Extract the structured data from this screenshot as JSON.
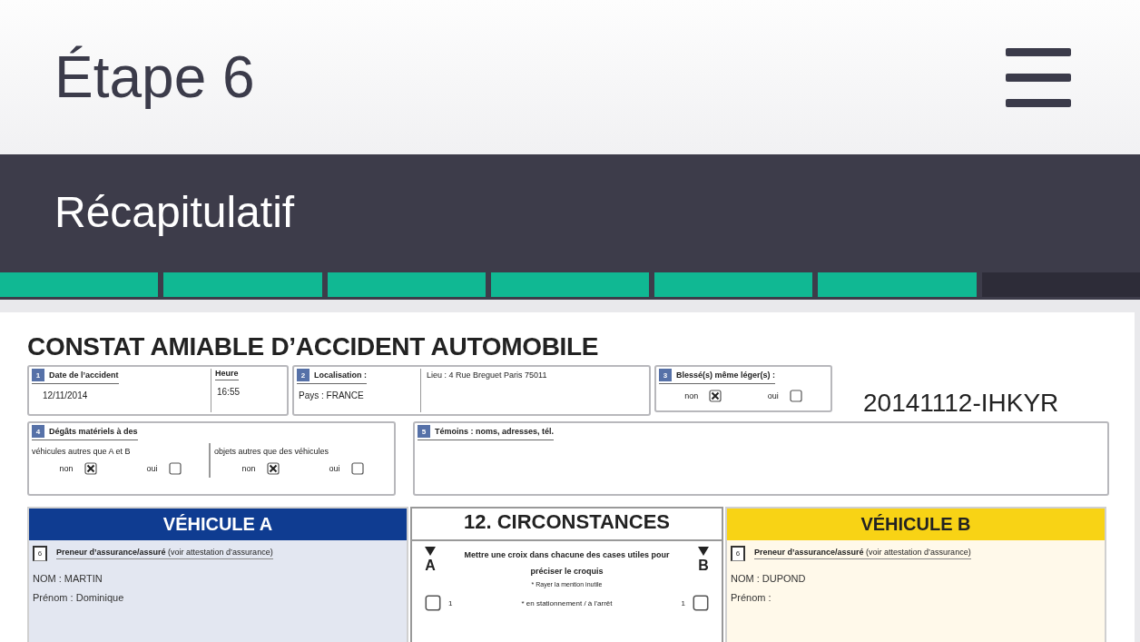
{
  "header": {
    "title": "Étape 6"
  },
  "section": {
    "title": "Récapitulatif"
  },
  "progress": [
    {
      "done": true
    },
    {
      "done": true
    },
    {
      "done": true
    },
    {
      "done": true
    },
    {
      "done": true
    },
    {
      "done": true
    },
    {
      "done": false
    }
  ],
  "form": {
    "title": "CONSTAT AMIABLE D’ACCIDENT AUTOMOBILE",
    "reference": "20141112-IHKYR",
    "date": {
      "number": "1",
      "label": "Date de l’accident",
      "value": "12/11/2014",
      "time_label": "Heure",
      "time_value": "16:55"
    },
    "location": {
      "number": "2",
      "label": "Localisation :",
      "country": "Pays :  FRANCE",
      "place": "Lieu : 4 Rue Breguet Paris 75011"
    },
    "injuries": {
      "number": "3",
      "label": "Blessé(s) même léger(s) :",
      "options": [
        {
          "label": "non",
          "checked": true
        },
        {
          "label": "oui",
          "checked": false
        }
      ]
    },
    "damage": {
      "number": "4",
      "label": "Dégâts matériels à des",
      "groups": [
        {
          "label": "véhicules autres que A et B",
          "options": [
            {
              "label": "non",
              "checked": true
            },
            {
              "label": "oui",
              "checked": false
            }
          ]
        },
        {
          "label": "objets autres que des véhicules",
          "options": [
            {
              "label": "non",
              "checked": true
            },
            {
              "label": "oui",
              "checked": false
            }
          ]
        }
      ]
    },
    "witnesses": {
      "number": "5",
      "label": "Témoins : noms, adresses, tél."
    },
    "vehicles": [
      {
        "kind": "a",
        "title": "VÉHICULE A",
        "number": "6",
        "label": "**Preneur d’assurance/assuré** (voir attestation d’assurance)",
        "fields": [
          "NOM :  MARTIN",
          "Prénom :  Dominique"
        ]
      },
      {
        "kind": "b",
        "title": "VÉHICULE B",
        "number": "6",
        "label": "**Preneur d’assurance/assuré** (voir attestation d’assurance)",
        "fields": [
          "NOM :  DUPOND",
          "Prénom :"
        ]
      }
    ],
    "circumstances": {
      "title": "12. CIRCONSTANCES",
      "marker_a": "A",
      "marker_b": "B",
      "instructions": "Mettre une croix dans chacune des cases utiles pour préciser le croquis",
      "note": "* Rayer la mention inutile",
      "items": [
        {
          "number_a": "1",
          "number_b": "1",
          "text": "* en stationnement / à l’arrêt",
          "a_checked": false,
          "b_checked": false
        }
      ]
    }
  }
}
